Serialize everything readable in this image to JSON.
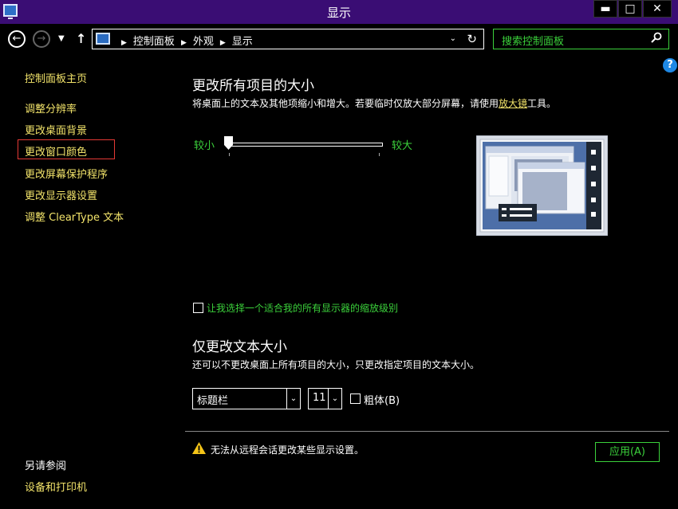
{
  "window": {
    "title": "显示",
    "minimize_glyph": "▬",
    "maximize_glyph": "□",
    "close_glyph": "✕"
  },
  "address_bar": {
    "crumbs": [
      "控制面板",
      "外观",
      "显示"
    ],
    "search_placeholder": "搜索控制面板"
  },
  "sidebar": {
    "home": "控制面板主页",
    "items": [
      "调整分辨率",
      "更改桌面背景",
      "更改窗口颜色",
      "更改屏幕保护程序",
      "更改显示器设置",
      "调整 ClearType 文本"
    ],
    "see_also_title": "另请参阅",
    "see_also_items": [
      "设备和打印机"
    ]
  },
  "main": {
    "heading": "更改所有项目的大小",
    "description_prefix": "将桌面上的文本及其他项缩小和增大。若要临时仅放大部分屏幕，请使用",
    "magnifier_link": "放大镜",
    "description_suffix": "工具。",
    "slider_min_label": "较小",
    "slider_max_label": "较大",
    "slider_value_fraction": 0.0,
    "scaling_checkbox_label": "让我选择一个适合我的所有显示器的缩放级别",
    "scaling_checked": false,
    "text_heading": "仅更改文本大小",
    "text_description": "还可以不更改桌面上所有项目的大小，只更改指定项目的文本大小。",
    "item_select_value": "标题栏",
    "size_select_value": "11",
    "bold_label": "粗体(B)",
    "bold_checked": false,
    "warning_text": "无法从远程会话更改某些显示设置。",
    "apply_label": "应用(A)",
    "help_glyph": "?"
  },
  "colors": {
    "titlebar": "#3a0d74",
    "link_yellow": "#f2e36a",
    "accent_green": "#3bd13b",
    "highlight_red": "#e53935"
  }
}
